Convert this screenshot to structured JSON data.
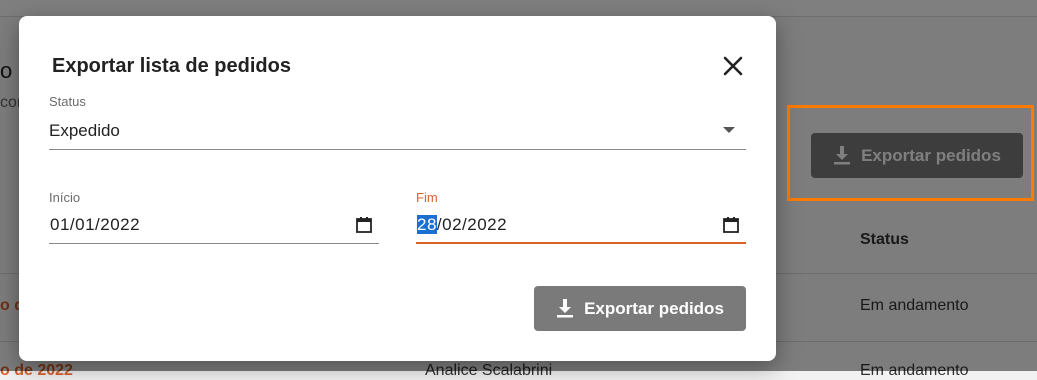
{
  "background": {
    "title_fragment": "o e",
    "subtitle_fragment": "con",
    "export_button_label": "Exportar pedidos",
    "table": {
      "status_header": "Status",
      "rows": [
        {
          "link": "o d",
          "status": "Em andamento"
        },
        {
          "link": "o de 2022",
          "client": "Analice Scalabrini",
          "status": "Em andamento"
        }
      ]
    },
    "highlight_color": "#ff7a00"
  },
  "modal": {
    "title": "Exportar lista de pedidos",
    "close_icon": "close-icon",
    "status_field": {
      "label": "Status",
      "value": "Expedido"
    },
    "start_field": {
      "label": "Início",
      "value": "01/01/2022"
    },
    "end_field": {
      "label": "Fim",
      "day": "28",
      "rest": "/02/2022"
    },
    "export_button_label": "Exportar pedidos",
    "accent_color": "#d9622b"
  }
}
